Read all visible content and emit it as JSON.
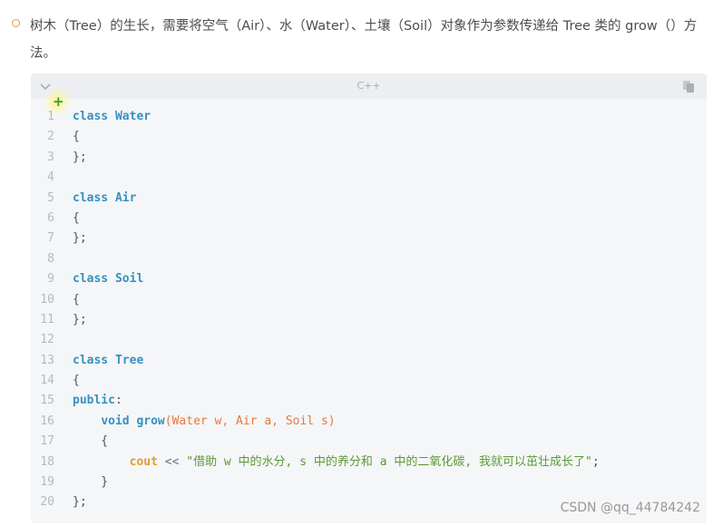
{
  "intro": {
    "text": "树木（Tree）的生长，需要将空气（Air）、水（Water）、土壤（Soil）对象作为参数传递给 Tree 类的 grow（）方法。"
  },
  "code_block": {
    "language": "C++",
    "icons": {
      "collapse": "chevron-down-icon",
      "copy": "copy-icon",
      "add": "plus-icon"
    },
    "lines": [
      {
        "n": "1",
        "tokens": [
          {
            "t": "class ",
            "c": "kw"
          },
          {
            "t": "Water",
            "c": "ty"
          }
        ]
      },
      {
        "n": "2",
        "tokens": [
          {
            "t": "{",
            "c": ""
          }
        ]
      },
      {
        "n": "3",
        "tokens": [
          {
            "t": "};",
            "c": ""
          }
        ]
      },
      {
        "n": "4",
        "tokens": []
      },
      {
        "n": "5",
        "tokens": [
          {
            "t": "class ",
            "c": "kw"
          },
          {
            "t": "Air",
            "c": "ty"
          }
        ]
      },
      {
        "n": "6",
        "tokens": [
          {
            "t": "{",
            "c": ""
          }
        ]
      },
      {
        "n": "7",
        "tokens": [
          {
            "t": "};",
            "c": ""
          }
        ]
      },
      {
        "n": "8",
        "tokens": []
      },
      {
        "n": "9",
        "tokens": [
          {
            "t": "class ",
            "c": "kw"
          },
          {
            "t": "Soil",
            "c": "ty"
          }
        ]
      },
      {
        "n": "10",
        "tokens": [
          {
            "t": "{",
            "c": ""
          }
        ]
      },
      {
        "n": "11",
        "tokens": [
          {
            "t": "};",
            "c": ""
          }
        ]
      },
      {
        "n": "12",
        "tokens": []
      },
      {
        "n": "13",
        "tokens": [
          {
            "t": "class ",
            "c": "kw"
          },
          {
            "t": "Tree",
            "c": "ty"
          }
        ]
      },
      {
        "n": "14",
        "tokens": [
          {
            "t": "{",
            "c": ""
          }
        ]
      },
      {
        "n": "15",
        "tokens": [
          {
            "t": "public",
            "c": "kw"
          },
          {
            "t": ":",
            "c": ""
          }
        ]
      },
      {
        "n": "16",
        "tokens": [
          {
            "t": "    ",
            "c": ""
          },
          {
            "t": "void ",
            "c": "kw"
          },
          {
            "t": "grow",
            "c": "fn"
          },
          {
            "t": "(Water w, Air a, Soil s)",
            "c": "pa"
          }
        ]
      },
      {
        "n": "17",
        "tokens": [
          {
            "t": "    {",
            "c": ""
          }
        ]
      },
      {
        "n": "18",
        "tokens": [
          {
            "t": "        ",
            "c": ""
          },
          {
            "t": "cout",
            "c": "cout"
          },
          {
            "t": " << ",
            "c": "op"
          },
          {
            "t": "\"借助 w 中的水分, s 中的养分和 a 中的二氧化碳, 我就可以茁壮成长了\"",
            "c": "str"
          },
          {
            "t": ";",
            "c": ""
          }
        ]
      },
      {
        "n": "19",
        "tokens": [
          {
            "t": "    }",
            "c": ""
          }
        ]
      },
      {
        "n": "20",
        "tokens": [
          {
            "t": "};",
            "c": ""
          }
        ]
      }
    ]
  },
  "watermark": "CSDN @qq_44784242",
  "colors": {
    "keyword": "#3591c2",
    "param": "#e4793f",
    "string": "#5c9a36",
    "bullet": "#e8953f"
  }
}
